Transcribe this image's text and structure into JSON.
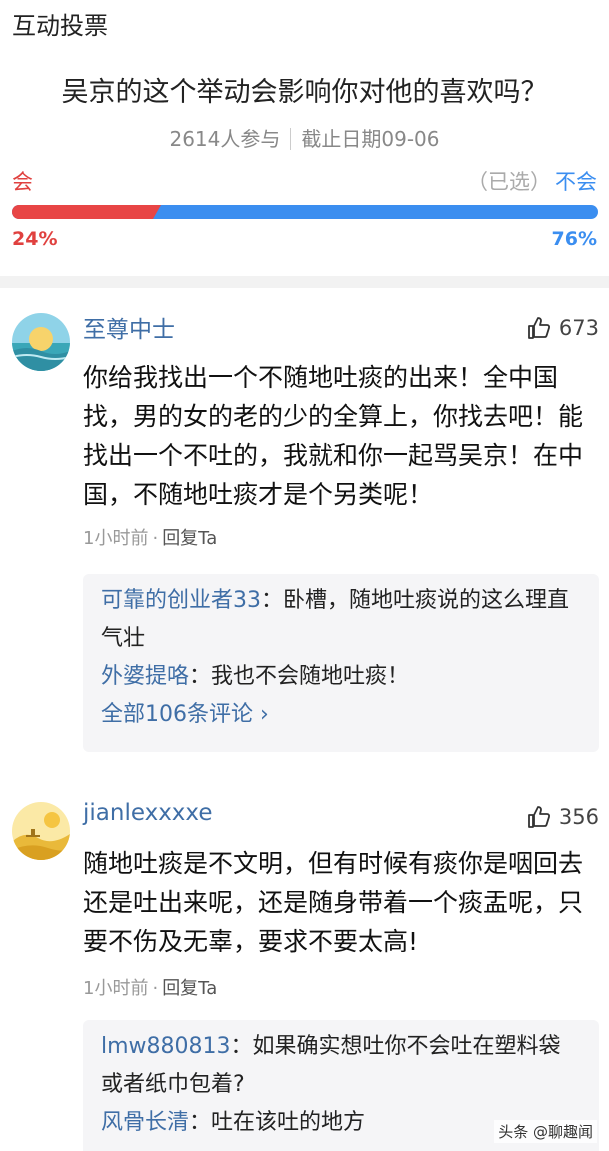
{
  "section": {
    "title": "互动投票"
  },
  "poll": {
    "question": "吴京的这个举动会影响你对他的喜欢吗？",
    "participants": "2614人参与",
    "deadline": "截止日期09-06",
    "option_left": {
      "label": "会",
      "percent_text": "24%",
      "fraction": 0.24,
      "color": "#e84545"
    },
    "option_right": {
      "chosen_tag": "（已选）",
      "label": "不会",
      "percent_text": "76%",
      "fraction": 0.76,
      "color": "#3b8ef0"
    }
  },
  "comments": [
    {
      "username": "至尊中士",
      "avatar_icon": "sunset-avatar-icon",
      "likes": "673",
      "text": "你给我找出一个不随地吐痰的出来！全中国找，男的女的老的少的全算上，你找去吧！能找出一个不吐的，我就和你一起骂吴京！在中国，不随地吐痰才是个另类呢！",
      "time": "1小时前",
      "reply_label": "回复Ta",
      "replies": [
        {
          "who": "可靠的创业者33",
          "text": "：卧槽，随地吐痰说的这么理直气壮"
        },
        {
          "who": "外婆提咯",
          "text": "：我也不会随地吐痰！"
        }
      ],
      "more": "全部106条评论 ›"
    },
    {
      "username": "jianlexxxxe",
      "avatar_icon": "desert-avatar-icon",
      "likes": "356",
      "text": "随地吐痰是不文明，但有时候有痰你是咽回去还是吐出来呢，还是随身带着一个痰盂呢，只要不伤及无辜，要求不要太高!",
      "time": "1小时前",
      "reply_label": "回复Ta",
      "replies": [
        {
          "who": "lmw880813",
          "text": "：如果确实想吐你不会吐在塑料袋或者纸巾包着?"
        },
        {
          "who": "风骨长清",
          "text": "：吐在该吐的地方"
        }
      ]
    }
  ],
  "watermark": "头条 @聊趣闻"
}
